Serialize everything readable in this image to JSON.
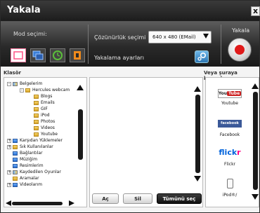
{
  "window": {
    "title": "Yakala",
    "close_label": "x"
  },
  "toolbar": {
    "mode_label": "Mod seçimi:",
    "modes": [
      {
        "icon": "region-select-icon",
        "selected": true,
        "color": "#ff7aa0"
      },
      {
        "icon": "window-select-icon",
        "selected": false,
        "color": "#3a7fd9"
      },
      {
        "icon": "timer-icon",
        "selected": false,
        "color": "#5bbf3a"
      },
      {
        "icon": "film-icon",
        "selected": false,
        "color": "#f08a1c"
      }
    ],
    "resolution_label": "Çözünürlük seçimi",
    "resolution_value": "640 x 480 (EMail)",
    "capture_settings_label": "Yakalama ayarları",
    "capture_label": "Yakala"
  },
  "folder_panel": {
    "heading": "Klasör",
    "items": [
      {
        "label": "Belgelerim",
        "expander": "-",
        "icon": "multi"
      },
      {
        "label": "Hercules webcam",
        "expander": "-",
        "icon": "yellow"
      },
      {
        "label": "Blogs",
        "icon": "yellow"
      },
      {
        "label": "Emails",
        "icon": "yellow"
      },
      {
        "label": "GIF",
        "icon": "yellow"
      },
      {
        "label": "iPod",
        "icon": "yellow"
      },
      {
        "label": "Photos",
        "icon": "yellow"
      },
      {
        "label": "Videos",
        "icon": "yellow"
      },
      {
        "label": "Youtube",
        "icon": "yellow"
      },
      {
        "label": "Karşıdan Yüklemeler",
        "expander": "+",
        "icon": "blue"
      },
      {
        "label": "Sık Kullanılanlar",
        "expander": "+",
        "icon": "yellow"
      },
      {
        "label": "Bağlantılar",
        "icon": "blue"
      },
      {
        "label": "Müziğim",
        "icon": "blue"
      },
      {
        "label": "Resimlerim",
        "icon": "blue"
      },
      {
        "label": "Kaydedilen Oyunlar",
        "expander": "+",
        "icon": "multi"
      },
      {
        "label": "Aramalar",
        "icon": "yellow"
      },
      {
        "label": "Videolarım",
        "expander": "+",
        "icon": "blue"
      }
    ]
  },
  "file_panel": {
    "open_label": "Aç",
    "delete_label": "Sil",
    "select_all_label": "Tümünü seç"
  },
  "destination_panel": {
    "heading": "Veya şuraya kopyala:",
    "youtube": {
      "logo_a": "You",
      "logo_b": "Tube",
      "label": "Youtube"
    },
    "facebook": {
      "logo": "facebook",
      "label": "Facebook"
    },
    "flickr": {
      "logo_a": "flick",
      "logo_b": "r",
      "label": "Flickr"
    },
    "ipod": {
      "label": "iPod®/"
    }
  }
}
